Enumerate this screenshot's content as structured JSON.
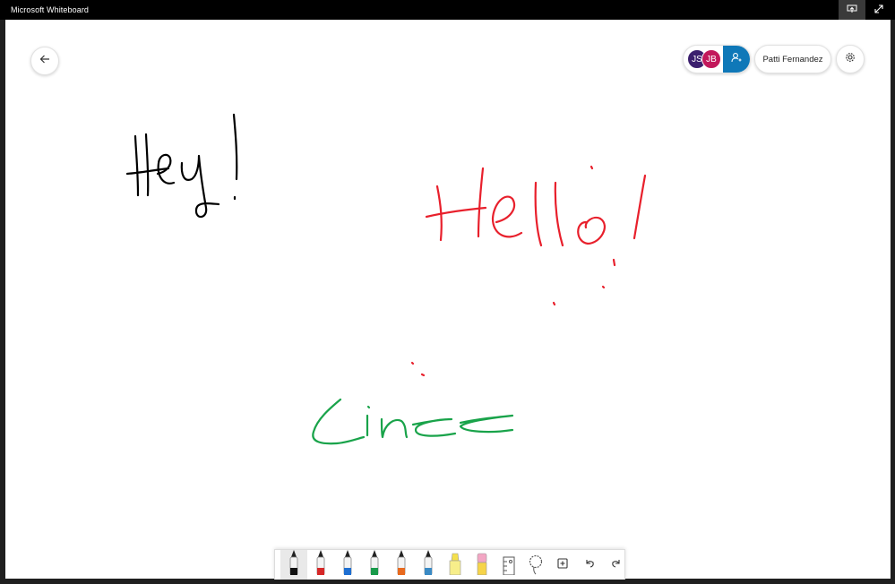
{
  "window": {
    "title": "Microsoft Whiteboard",
    "buttons": [
      {
        "name": "share-screen-icon",
        "active": true
      },
      {
        "name": "fullscreen-icon",
        "active": false
      }
    ]
  },
  "header": {
    "participants": [
      {
        "initials": "JS",
        "color": "#3b1f6e"
      },
      {
        "initials": "JB",
        "color": "#c2185b"
      }
    ],
    "invite_color": "#0f78b8",
    "user_name": "Patti Fernandez"
  },
  "board": {
    "ink": [
      {
        "text": "Hey!",
        "color": "#000000"
      },
      {
        "text": "Hello!",
        "color": "#e8202c"
      },
      {
        "text": "Lines",
        "color": "#19a34a"
      }
    ]
  },
  "toolbar": {
    "tools": [
      {
        "name": "black-pen",
        "color": "#111111",
        "selected": true
      },
      {
        "name": "red-pen",
        "color": "#d62828"
      },
      {
        "name": "blue-pen",
        "color": "#1f6fd1"
      },
      {
        "name": "green-pen",
        "color": "#1a9a4b"
      },
      {
        "name": "rainbow-pen",
        "color": "#e86a1f"
      },
      {
        "name": "galaxy-pen",
        "color": "#3a8ac4"
      },
      {
        "name": "highlighter",
        "color": "#f4e04d"
      },
      {
        "name": "eraser",
        "color": "#f3a6c4"
      },
      {
        "name": "ruler",
        "color": "#555555"
      },
      {
        "name": "lasso",
        "color": "#555555"
      },
      {
        "name": "add",
        "color": "#555555"
      },
      {
        "name": "undo",
        "color": "#555555"
      },
      {
        "name": "redo",
        "color": "#555555"
      }
    ]
  }
}
